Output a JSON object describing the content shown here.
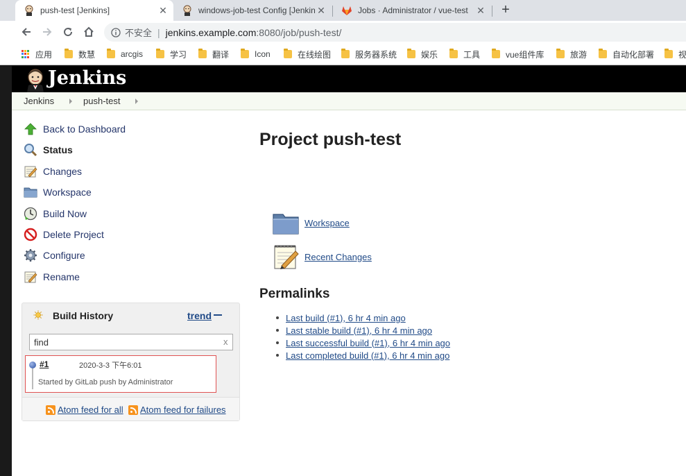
{
  "browser": {
    "tabs": [
      {
        "title": "push-test [Jenkins]",
        "favicon": "jenkins-icon",
        "active": true
      },
      {
        "title": "windows-job-test Config [Jenkins]",
        "favicon": "jenkins-icon",
        "active": false
      },
      {
        "title": "Jobs · Administrator / vue-test",
        "favicon": "gitlab-icon",
        "active": false
      }
    ],
    "new_tab_label": "+",
    "address": {
      "security_label": "不安全",
      "host": "jenkins.example.com",
      "rest": ":8080/job/push-test/"
    },
    "bookmarks": [
      {
        "label": "应用",
        "icon": "apps-grid-icon"
      },
      {
        "label": "数慧",
        "icon": "folder-icon"
      },
      {
        "label": "arcgis",
        "icon": "folder-icon"
      },
      {
        "label": "学习",
        "icon": "folder-icon"
      },
      {
        "label": "翻译",
        "icon": "folder-icon"
      },
      {
        "label": "Icon",
        "icon": "folder-icon"
      },
      {
        "label": "在线绘图",
        "icon": "folder-icon"
      },
      {
        "label": "服务器系统",
        "icon": "folder-icon"
      },
      {
        "label": "娱乐",
        "icon": "folder-icon"
      },
      {
        "label": "工具",
        "icon": "folder-icon"
      },
      {
        "label": "vue组件库",
        "icon": "folder-icon"
      },
      {
        "label": "旅游",
        "icon": "folder-icon"
      },
      {
        "label": "自动化部署",
        "icon": "folder-icon"
      },
      {
        "label": "视",
        "icon": "folder-icon"
      }
    ]
  },
  "jenkins": {
    "header_title": "Jenkins",
    "breadcrumbs": [
      "Jenkins",
      "push-test"
    ],
    "tasks": [
      {
        "label": "Back to Dashboard",
        "icon": "up-arrow-icon"
      },
      {
        "label": "Status",
        "icon": "magnifier-icon"
      },
      {
        "label": "Changes",
        "icon": "notepad-icon"
      },
      {
        "label": "Workspace",
        "icon": "folder-icon"
      },
      {
        "label": "Build Now",
        "icon": "build-clock-icon"
      },
      {
        "label": "Delete Project",
        "icon": "no-entry-icon"
      },
      {
        "label": "Configure",
        "icon": "gear-icon"
      },
      {
        "label": "Rename",
        "icon": "notepad-icon"
      }
    ],
    "build_history": {
      "title": "Build History",
      "trend_label": "trend",
      "search_value": "find",
      "clear_label": "x",
      "builds": [
        {
          "number": "#1",
          "date": "2020-3-3 下午6:01",
          "cause": "Started by GitLab push by Administrator"
        }
      ],
      "feeds": [
        "Atom feed for all",
        "Atom feed for failures"
      ]
    },
    "main": {
      "project_title": "Project push-test",
      "links": [
        {
          "label": "Workspace",
          "icon": "folder-icon"
        },
        {
          "label": "Recent Changes",
          "icon": "notepad-icon"
        }
      ],
      "permalinks_title": "Permalinks",
      "permalinks": [
        "Last build (#1), 6 hr 4 min ago",
        "Last stable build (#1), 6 hr 4 min ago",
        "Last successful build (#1), 6 hr 4 min ago",
        "Last completed build (#1), 6 hr 4 min ago"
      ]
    }
  }
}
